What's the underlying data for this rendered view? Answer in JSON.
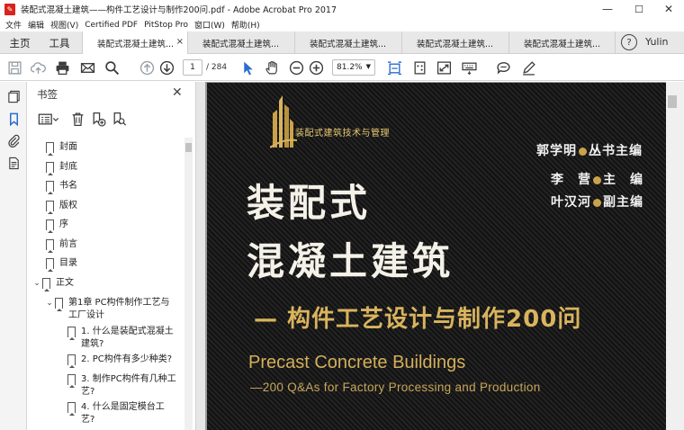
{
  "window": {
    "title": "装配式混凝土建筑——构件工艺设计与制作200问.pdf - Adobe Acrobat Pro 2017",
    "minimize": "—",
    "maximize": "☐",
    "close": "✕"
  },
  "menu": [
    "文件",
    "编辑",
    "视图(V)",
    "Certified PDF",
    "PitStop Pro",
    "窗口(W)",
    "帮助(H)"
  ],
  "tabs": {
    "home": "主页",
    "tools": "工具",
    "docs": [
      "装配式混凝土建筑...",
      "装配式混凝土建筑...",
      "装配式混凝土建筑...",
      "装配式混凝土建筑...",
      "装配式混凝土建筑..."
    ],
    "close": "×",
    "help": "?",
    "user": "Yulin"
  },
  "toolbar": {
    "page": "1",
    "page_total": "/ 284",
    "zoom": "81.2%",
    "icons": [
      "save-icon",
      "upload-icon",
      "print-icon",
      "mail-icon",
      "search-icon",
      "prev-page-icon",
      "next-page-icon",
      "select-arrow-icon",
      "hand-icon",
      "zoom-out-icon",
      "zoom-in-icon",
      "fit-width-icon",
      "rotate-icon",
      "fullscreen-icon",
      "keyboard-icon",
      "comment-icon",
      "pen-icon"
    ]
  },
  "bookmarks": {
    "header": "书签",
    "items": [
      {
        "label": "封面",
        "level": 0
      },
      {
        "label": "封底",
        "level": 0
      },
      {
        "label": "书名",
        "level": 0
      },
      {
        "label": "版权",
        "level": 0
      },
      {
        "label": "序",
        "level": 0
      },
      {
        "label": "前言",
        "level": 0
      },
      {
        "label": "目录",
        "level": 0
      },
      {
        "label": "正文",
        "level": 0
      },
      {
        "label": "第1章 PC构件制作工艺与",
        "label2": "工厂设计",
        "level": 1
      },
      {
        "label": "1. 什么是装配式混凝土",
        "label2": "建筑?",
        "level": 2
      },
      {
        "label": "2. PC构件有多少种类?",
        "level": 2
      },
      {
        "label": "3. 制作PC构件有几种工",
        "label2": "艺?",
        "level": 2
      },
      {
        "label": "4. 什么是固定模台工",
        "label2": "艺?",
        "level": 2
      }
    ]
  },
  "cover": {
    "series": "装配式建筑技术与管理",
    "editor_chief": [
      "郭学明",
      "丛书主编"
    ],
    "editor_main": [
      "李　营",
      "主　编"
    ],
    "editor_vice": [
      "叶汉河",
      "副主编"
    ],
    "title1": "装配式",
    "title2": "混凝土建筑",
    "subtitle": "— 构件工艺设计与制作200问",
    "en_title": "Precast Concrete Buildings",
    "en_subtitle": "—200 Q&As for Factory Processing and Production"
  },
  "colors": {
    "accent_gold": "#d9b45e",
    "app_red": "#d8241c",
    "icon_blue": "#2b6cd0"
  }
}
